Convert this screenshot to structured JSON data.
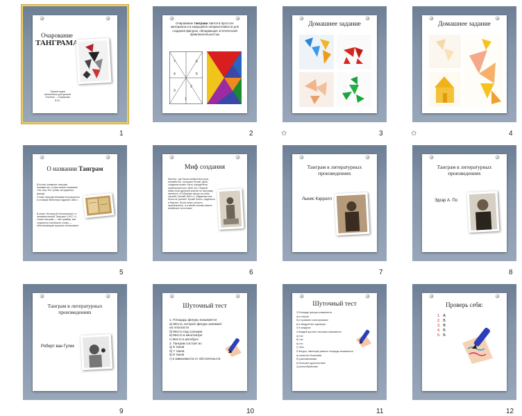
{
  "slides": [
    {
      "number": "1",
      "title_line1": "Очарование",
      "title_line2": "ТАНГРАМА",
      "credits": "Презентация выполнена для уроков Учитель — Ермакова Е.Ю."
    },
    {
      "number": "2",
      "text_pre": "Очарование ",
      "text_bold": "танграма",
      "text_post": " таится в простоте материала и в кажущейся неприхотливости для создания фигурок, обладающих эстетической привлекательностью",
      "grid_numbers": [
        "7",
        "6",
        "4",
        "5",
        "3",
        "2",
        "1"
      ]
    },
    {
      "number": "3",
      "title": "Домашнее задание"
    },
    {
      "number": "4",
      "title": "Домашнее задание"
    },
    {
      "number": "5",
      "title_pre": "О названии ",
      "title_bold": "Танграм",
      "para1": "В Китае название танграм неизвестно, а игра имеет название «Чи-Чао-Тю» (семь хитроумных фигур).",
      "para2": "Слово танграм впервые встречается в словаре Вебстера издания 1864 г.",
      "para3": "В книге «Большой Иллюзионист и занимательный Танграм» (1917 г.) слово танграм — тан-грамма, как старинное китайское слово — обозначающая игрушки пятачковые."
    },
    {
      "number": "6",
      "title": "Миф создания",
      "text": "Мастер, где была изобретена игра, неизвестно, полагают Китай. Дата создания может быть определена приблизительно 4000 лет. Первой известной древней книгой по танграму является «Собрание фигур из семи частей» (Китай 1803 г.). Изданная она была не ранней. Кроме Книги, изданные в Европе, были лишь отчасти оригинальны, а в своей основе имели китайские источники."
    },
    {
      "number": "7",
      "title": "Танграм в литературных произведениях",
      "author": "Льюис Кэрролл"
    },
    {
      "number": "8",
      "title": "Танграм в литературных произведениях",
      "author": "Эдгар А. По"
    },
    {
      "number": "9",
      "title": "Танграм в литературных произведениях",
      "author": "Роберт ван Гулик"
    },
    {
      "number": "10",
      "title": "Шуточный тест",
      "lines": [
        "1. Площадь фигуры называется",
        "а) Место, которое фигура занимает на плоскости",
        "б) Место под солнцем",
        "в) Место в кинотеатре",
        "г) Место в автобусе",
        "2. Танграм состоит из",
        "а) 5 танов",
        "б) 7 танов",
        "в) 8 танов",
        "г) в зависимости от обстоятельств"
      ]
    },
    {
      "number": "11",
      "title": "Шуточный тест",
      "lines": [
        "3.Площадь фигуры измеряется",
        "а) в литрах",
        "б) в граммах и килограммах",
        "в) в квадратных единицах",
        "г) в градусах",
        "4.Каждый кусочек танграма называется",
        "а) тан",
        "б) тян",
        "в) тон",
        "г) тинь",
        "5.Фигуры, имеющие равные площади называются",
        "а) сказочно большими",
        "б) равновеликими",
        "в) большое удовольствие",
        "г) разнообразными"
      ]
    },
    {
      "number": "12",
      "title": "Проверь себя:",
      "answers": [
        {
          "n": "1.",
          "v": "А"
        },
        {
          "n": "2.",
          "v": "Б"
        },
        {
          "n": "3.",
          "v": "В"
        },
        {
          "n": "4.",
          "v": "Б"
        },
        {
          "n": "5.",
          "v": "Б"
        }
      ]
    }
  ],
  "colors": {
    "selection": "#f0cf5c",
    "slide_bg_top": "#6d7f95",
    "answer_red": "#c01515"
  },
  "icons": {
    "transition": "star-icon"
  }
}
